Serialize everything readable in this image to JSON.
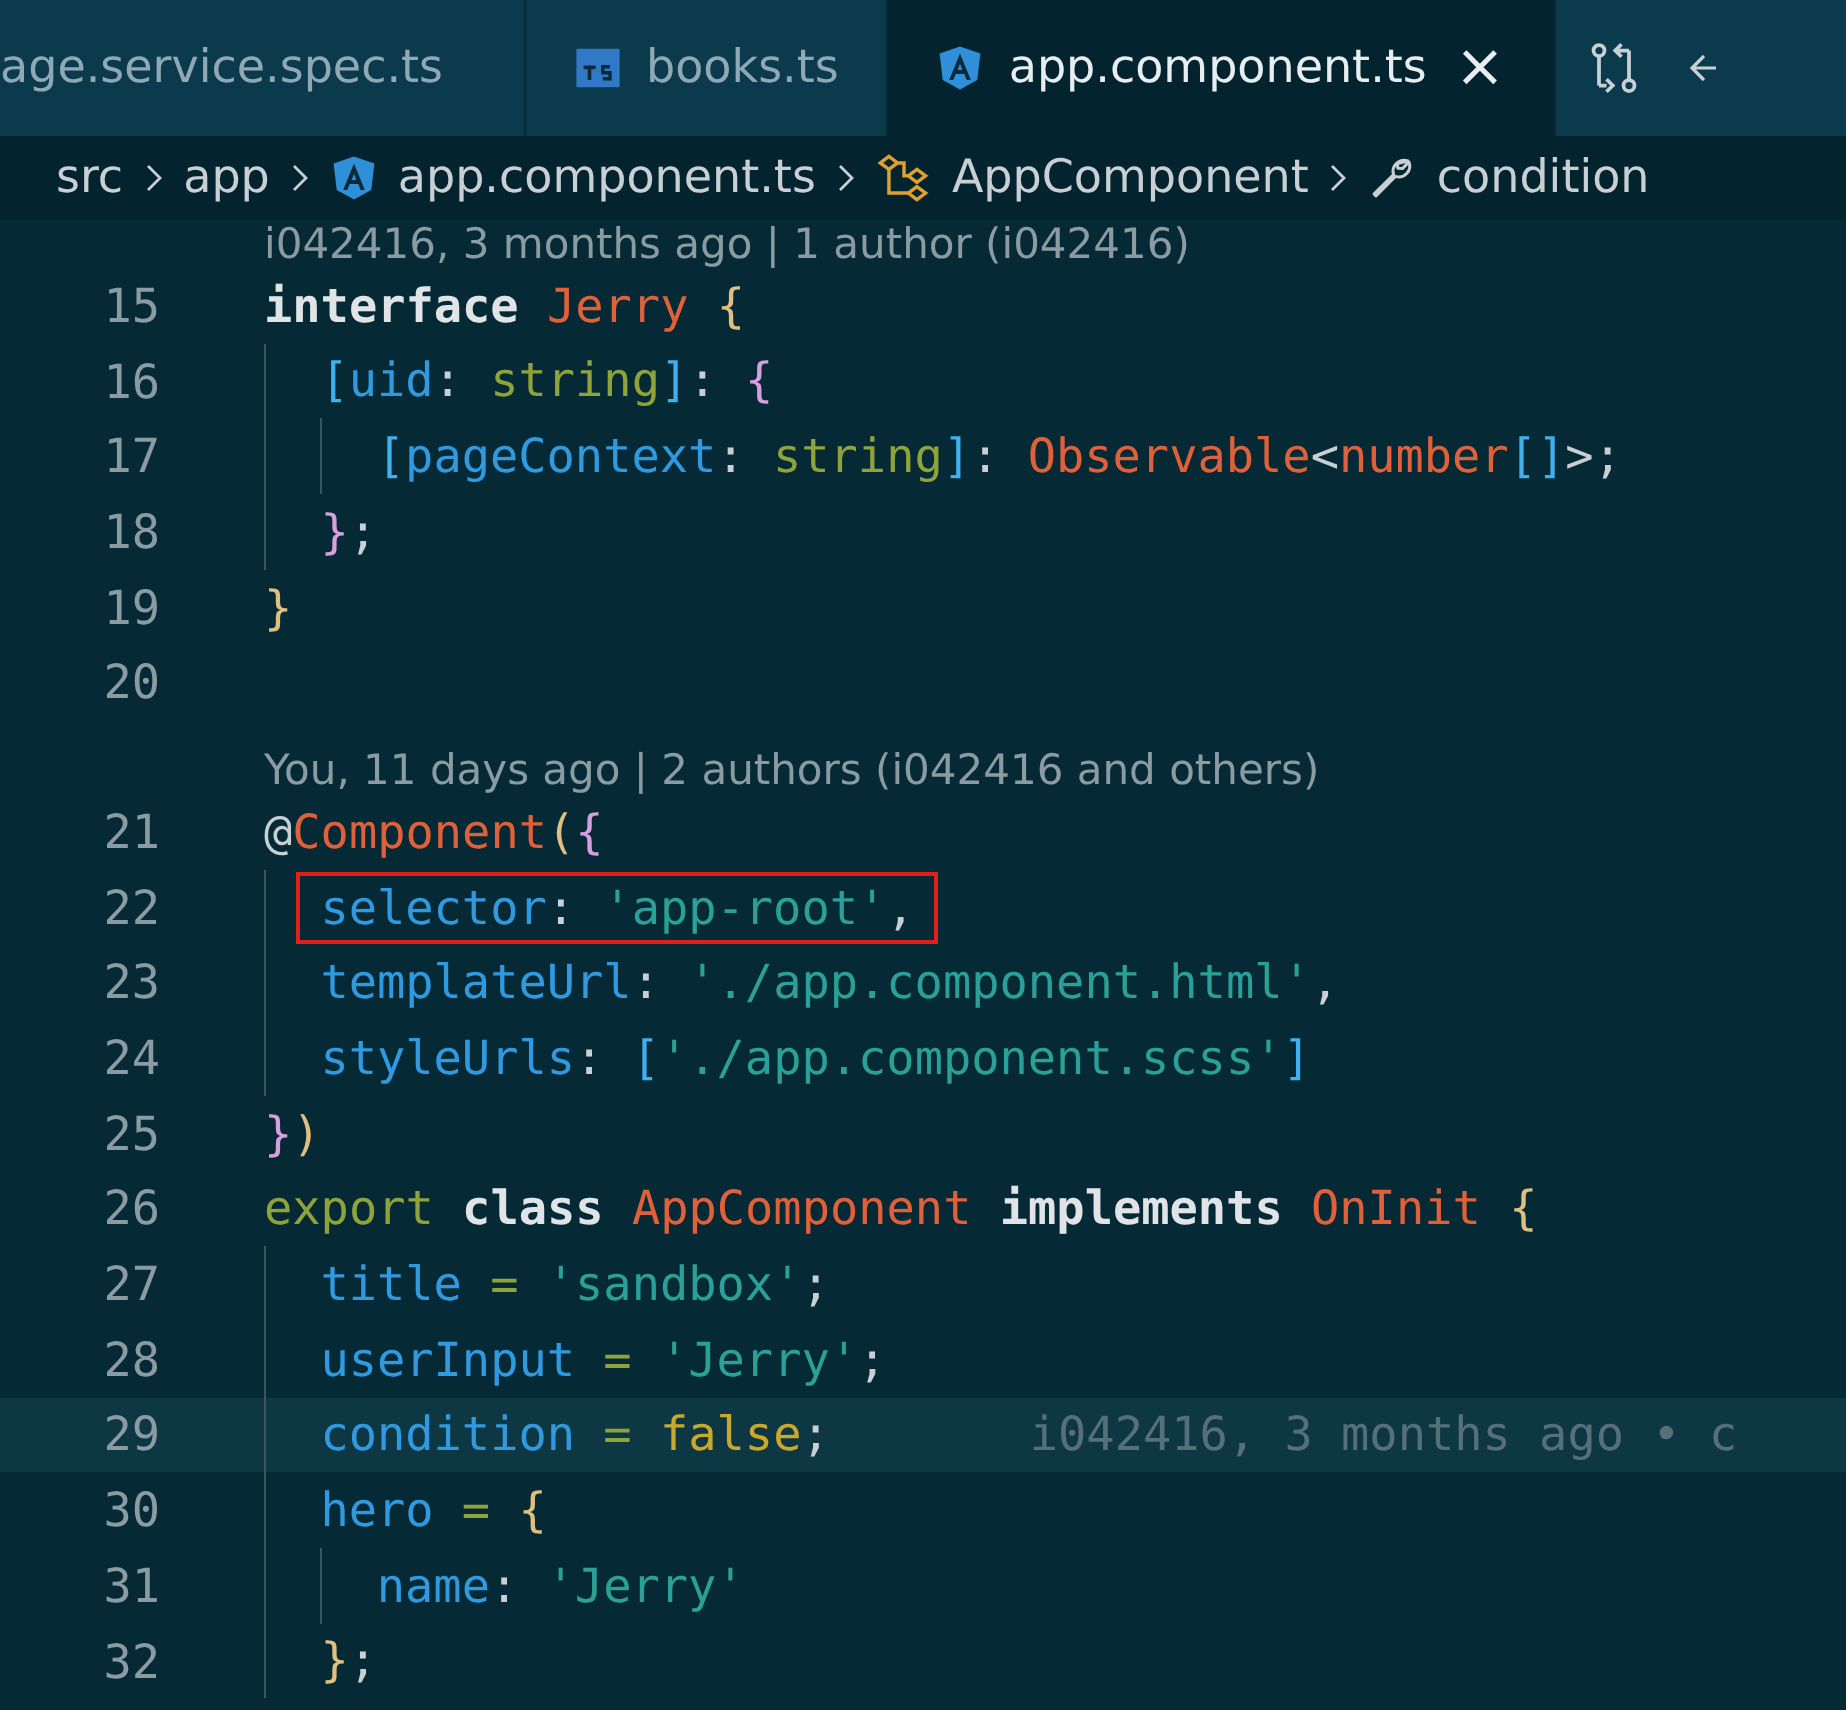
{
  "tabs": [
    {
      "label": "age.service.spec.ts",
      "kind": "plain",
      "selected": false
    },
    {
      "label": "books.ts",
      "kind": "typescript",
      "selected": false
    },
    {
      "label": "app.component.ts",
      "kind": "angular",
      "selected": true
    }
  ],
  "tab_close": "×",
  "breadcrumb": [
    {
      "label": "src",
      "kind": "plain"
    },
    {
      "label": "app",
      "kind": "plain"
    },
    {
      "label": "app.component.ts",
      "kind": "angular"
    },
    {
      "label": "AppComponent",
      "kind": "class"
    },
    {
      "label": "condition",
      "kind": "property"
    }
  ],
  "editor": {
    "rows": [
      {
        "kind": "lens",
        "text": "i042416, 3 months ago | 1 author (i042416)"
      },
      {
        "kind": "code",
        "number": "15",
        "boxed": false,
        "current": false,
        "tokens": [
          {
            "kind": "kwb",
            "text": "interface "
          },
          {
            "kind": "type",
            "text": "Jerry "
          },
          {
            "kind": "by",
            "text": "{"
          }
        ]
      },
      {
        "kind": "code",
        "number": "16",
        "boxed": false,
        "current": false,
        "tokens": [
          {
            "kind": "bb",
            "text": "  ["
          },
          {
            "kind": "prop",
            "text": "uid"
          },
          {
            "kind": "p",
            "text": ": "
          },
          {
            "kind": "kw",
            "text": "string"
          },
          {
            "kind": "bb",
            "text": "]"
          },
          {
            "kind": "p",
            "text": ": "
          },
          {
            "kind": "bp",
            "text": "{"
          }
        ]
      },
      {
        "kind": "code",
        "number": "17",
        "boxed": false,
        "current": false,
        "tokens": [
          {
            "kind": "bb",
            "text": "    ["
          },
          {
            "kind": "prop",
            "text": "pageContext"
          },
          {
            "kind": "p",
            "text": ": "
          },
          {
            "kind": "kw",
            "text": "string"
          },
          {
            "kind": "bb",
            "text": "]"
          },
          {
            "kind": "p",
            "text": ": "
          },
          {
            "kind": "type",
            "text": "Observable"
          },
          {
            "kind": "p",
            "text": "<"
          },
          {
            "kind": "type",
            "text": "number"
          },
          {
            "kind": "bb",
            "text": "[]"
          },
          {
            "kind": "p",
            "text": ">;"
          }
        ]
      },
      {
        "kind": "code",
        "number": "18",
        "boxed": false,
        "current": false,
        "tokens": [
          {
            "kind": "bp",
            "text": "  }"
          },
          {
            "kind": "p",
            "text": ";"
          }
        ]
      },
      {
        "kind": "code",
        "number": "19",
        "boxed": false,
        "current": false,
        "tokens": [
          {
            "kind": "by",
            "text": "}"
          }
        ]
      },
      {
        "kind": "code",
        "number": "20",
        "current": false,
        "tokens": []
      },
      {
        "kind": "lens",
        "text": "You, 11 days ago | 2 authors (i042416 and others)"
      },
      {
        "kind": "code",
        "number": "21",
        "boxed": false,
        "current": false,
        "tokens": [
          {
            "kind": "p",
            "text": "@"
          },
          {
            "kind": "type",
            "text": "Component"
          },
          {
            "kind": "by",
            "text": "("
          },
          {
            "kind": "bp",
            "text": "{"
          }
        ]
      },
      {
        "kind": "code",
        "number": "22",
        "boxed": true,
        "current": false,
        "tokens": [
          {
            "kind": "prop",
            "text": "  selector"
          },
          {
            "kind": "p",
            "text": ": "
          },
          {
            "kind": "str",
            "text": "'app-root'"
          },
          {
            "kind": "p",
            "text": ","
          }
        ]
      },
      {
        "kind": "code",
        "number": "23",
        "boxed": false,
        "current": false,
        "tokens": [
          {
            "kind": "prop",
            "text": "  templateUrl"
          },
          {
            "kind": "p",
            "text": ": "
          },
          {
            "kind": "str",
            "text": "'./app.component.html'"
          },
          {
            "kind": "p",
            "text": ","
          }
        ]
      },
      {
        "kind": "code",
        "number": "24",
        "boxed": false,
        "current": false,
        "tokens": [
          {
            "kind": "prop",
            "text": "  styleUrls"
          },
          {
            "kind": "p",
            "text": ": "
          },
          {
            "kind": "bb",
            "text": "["
          },
          {
            "kind": "str",
            "text": "'./app.component.scss'"
          },
          {
            "kind": "bb",
            "text": "]"
          }
        ]
      },
      {
        "kind": "code",
        "number": "25",
        "boxed": false,
        "current": false,
        "tokens": [
          {
            "kind": "bp",
            "text": "}"
          },
          {
            "kind": "by",
            "text": ")"
          }
        ]
      },
      {
        "kind": "code",
        "number": "26",
        "boxed": false,
        "current": false,
        "tokens": [
          {
            "kind": "kw",
            "text": "export "
          },
          {
            "kind": "kwb",
            "text": "class "
          },
          {
            "kind": "type",
            "text": "AppComponent "
          },
          {
            "kind": "kwb",
            "text": "implements "
          },
          {
            "kind": "type",
            "text": "OnInit "
          },
          {
            "kind": "by",
            "text": "{"
          }
        ]
      },
      {
        "kind": "code",
        "number": "27",
        "boxed": false,
        "current": false,
        "tokens": [
          {
            "kind": "prop",
            "text": "  title"
          },
          {
            "kind": "op",
            "text": " = "
          },
          {
            "kind": "str",
            "text": "'sandbox'"
          },
          {
            "kind": "p",
            "text": ";"
          }
        ]
      },
      {
        "kind": "code",
        "number": "28",
        "boxed": false,
        "current": false,
        "tokens": [
          {
            "kind": "prop",
            "text": "  userInput"
          },
          {
            "kind": "op",
            "text": " = "
          },
          {
            "kind": "str",
            "text": "'Jerry'"
          },
          {
            "kind": "p",
            "text": ";"
          }
        ]
      },
      {
        "kind": "code",
        "number": "29",
        "boxed": false,
        "current": true,
        "blame": "i042416, 3 months ago • c",
        "tokens": [
          {
            "kind": "prop",
            "text": "  condition"
          },
          {
            "kind": "op",
            "text": " = "
          },
          {
            "kind": "bool",
            "text": "false"
          },
          {
            "kind": "p",
            "text": ";"
          }
        ]
      },
      {
        "kind": "code",
        "number": "30",
        "boxed": false,
        "current": false,
        "tokens": [
          {
            "kind": "prop",
            "text": "  hero"
          },
          {
            "kind": "op",
            "text": " = "
          },
          {
            "kind": "by",
            "text": "{"
          }
        ]
      },
      {
        "kind": "code",
        "number": "31",
        "boxed": false,
        "current": false,
        "tokens": [
          {
            "kind": "prop",
            "text": "    name"
          },
          {
            "kind": "p",
            "text": ": "
          },
          {
            "kind": "str",
            "text": "'Jerry'"
          }
        ]
      },
      {
        "kind": "code",
        "number": "32",
        "boxed": false,
        "current": false,
        "tokens": [
          {
            "kind": "by",
            "text": "  }"
          },
          {
            "kind": "p",
            "text": ";"
          }
        ]
      }
    ]
  }
}
